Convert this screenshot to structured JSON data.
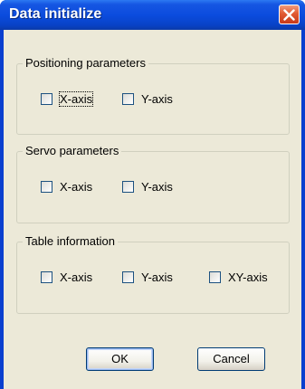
{
  "window": {
    "title": "Data initialize"
  },
  "groups": [
    {
      "label": "Positioning parameters",
      "options": [
        {
          "label": "X-axis",
          "checked": false
        },
        {
          "label": "Y-axis",
          "checked": false
        }
      ]
    },
    {
      "label": "Servo parameters",
      "options": [
        {
          "label": "X-axis",
          "checked": false
        },
        {
          "label": "Y-axis",
          "checked": false
        }
      ]
    },
    {
      "label": "Table information",
      "options": [
        {
          "label": "X-axis",
          "checked": false
        },
        {
          "label": "Y-axis",
          "checked": false
        },
        {
          "label": "XY-axis",
          "checked": false
        }
      ]
    }
  ],
  "buttons": {
    "ok_label": "OK",
    "cancel_label": "Cancel"
  },
  "colors": {
    "titlebar": "#0b4cde",
    "dialog_bg": "#ece9d8",
    "close_button": "#e15a33"
  },
  "icons": {
    "close": "close-icon"
  }
}
